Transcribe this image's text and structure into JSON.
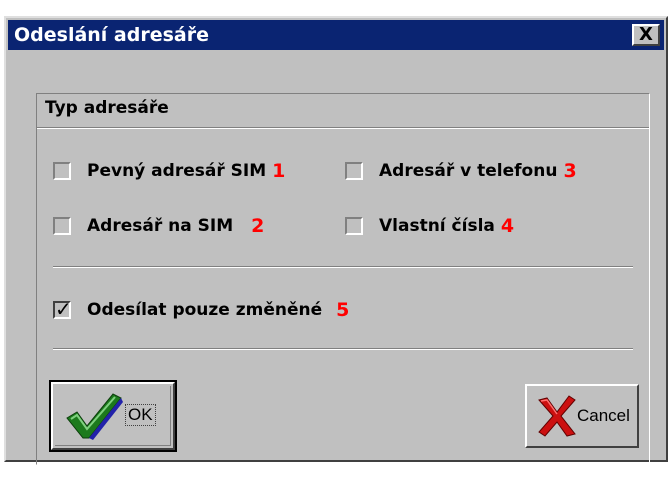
{
  "window": {
    "title": "Odeslání adresáře",
    "close_glyph": "X"
  },
  "group": {
    "label": "Typ adresáře"
  },
  "options": [
    {
      "label": "Pevný adresář SIM",
      "number": "1",
      "checked": false
    },
    {
      "label": "Adresář v telefonu",
      "number": "3",
      "checked": false
    },
    {
      "label": "Adresář na SIM",
      "number": "2",
      "checked": false
    },
    {
      "label": "Vlastní čísla",
      "number": "4",
      "checked": false
    }
  ],
  "send_changed": {
    "label": "Odesílat pouze změněné",
    "number": "5",
    "checked": true,
    "tick": "✓"
  },
  "buttons": {
    "ok": "OK",
    "cancel": "Cancel"
  },
  "icons": {
    "ok": "checkmark-icon",
    "cancel": "red-x-icon"
  },
  "colors": {
    "titlebar": "#0a2472",
    "dialog": "#c0c0c0",
    "annotation": "#ff0000"
  }
}
